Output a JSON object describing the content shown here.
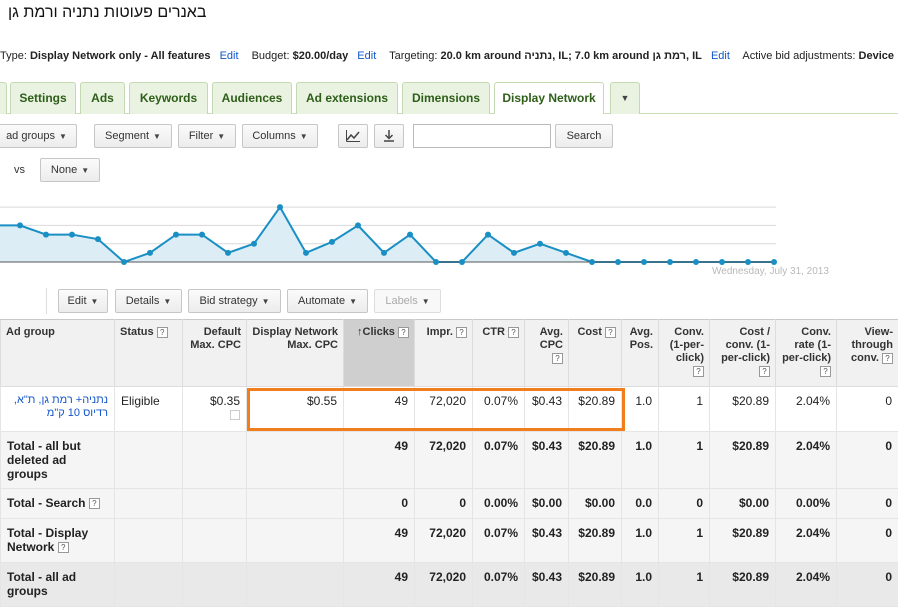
{
  "page": {
    "title": "באנרים פעוטות נתניה ורמת גן"
  },
  "infobar": {
    "type_label": "Type:",
    "type_value": "Display Network only - All features",
    "budget_label": "Budget:",
    "budget_value": "$20.00/day",
    "targeting_label": "Targeting:",
    "targeting_value": "20.0 km around נתניה, IL; 7.0 km around רמת גן, IL",
    "bid_adj_label": "Active bid adjustments:",
    "bid_adj_value": "Device",
    "edit_label": "Edit"
  },
  "tabs": [
    {
      "label": "Settings"
    },
    {
      "label": "Ads"
    },
    {
      "label": "Keywords"
    },
    {
      "label": "Audiences"
    },
    {
      "label": "Ad extensions"
    },
    {
      "label": "Dimensions"
    },
    {
      "label": "Display Network"
    },
    {
      "label": "▼"
    }
  ],
  "toolbar": {
    "adgroups_label": "ad groups",
    "segment_label": "Segment",
    "filter_label": "Filter",
    "columns_label": "Columns",
    "search_placeholder": "",
    "search_label": "Search",
    "chart_icon": "line-chart-icon",
    "download_icon": "download-icon"
  },
  "compare": {
    "vs_label": "vs",
    "none_label": "None"
  },
  "chart": {
    "date_label": "Wednesday, July 31, 2013",
    "line_color": "#1a8fc4"
  },
  "chart_data": {
    "type": "area",
    "title": "",
    "xlabel": "",
    "ylabel": "",
    "x_end_label": "Wednesday, July 31, 2013",
    "values": [
      4,
      4,
      3,
      3,
      2.5,
      0,
      1,
      3,
      3,
      1,
      2,
      6,
      1,
      2.2,
      4,
      1,
      3,
      0,
      0,
      3,
      1,
      2,
      1,
      0,
      0,
      0,
      0,
      0,
      0,
      0,
      0
    ],
    "ylim": [
      0,
      7
    ],
    "grid": true
  },
  "actions": {
    "edit_label": "Edit",
    "details_label": "Details",
    "bid_strategy_label": "Bid strategy",
    "automate_label": "Automate",
    "labels_label": "Labels"
  },
  "table": {
    "headers": {
      "adgroup": "Ad group",
      "status": "Status",
      "default_cpc": "Default Max. CPC",
      "display_cpc": "Display Network Max. CPC",
      "clicks": "Clicks",
      "impr": "Impr.",
      "ctr": "CTR",
      "avg_cpc": "Avg. CPC",
      "cost": "Cost",
      "avg_pos": "Avg. Pos.",
      "conv": "Conv. (1-per-click)",
      "cost_conv": "Cost / conv. (1-per-click)",
      "conv_rate": "Conv. rate (1-per-click)",
      "view_through": "View-through conv."
    },
    "help_glyph": "?",
    "sort_glyph": "↑",
    "row": {
      "adgroup": "נתניה+ רמת גן, ת\"א, רדיוס 10 ק\"מ",
      "status": "Eligible",
      "default_cpc": "$0.35",
      "display_cpc": "$0.55",
      "clicks": "49",
      "impr": "72,020",
      "ctr": "0.07%",
      "avg_cpc": "$0.43",
      "cost": "$20.89",
      "avg_pos": "1.0",
      "conv": "1",
      "cost_conv": "$20.89",
      "conv_rate": "2.04%",
      "view_through": "0"
    },
    "totals": [
      {
        "label": "Total - all but deleted ad groups",
        "clicks": "49",
        "impr": "72,020",
        "ctr": "0.07%",
        "avg_cpc": "$0.43",
        "cost": "$20.89",
        "avg_pos": "1.0",
        "conv": "1",
        "cost_conv": "$20.89",
        "conv_rate": "2.04%",
        "view_through": "0"
      },
      {
        "label": "Total - Search",
        "clicks": "0",
        "impr": "0",
        "ctr": "0.00%",
        "avg_cpc": "$0.00",
        "cost": "$0.00",
        "avg_pos": "0.0",
        "conv": "0",
        "cost_conv": "$0.00",
        "conv_rate": "0.00%",
        "view_through": "0"
      },
      {
        "label": "Total - Display Network",
        "clicks": "49",
        "impr": "72,020",
        "ctr": "0.07%",
        "avg_cpc": "$0.43",
        "cost": "$20.89",
        "avg_pos": "1.0",
        "conv": "1",
        "cost_conv": "$20.89",
        "conv_rate": "2.04%",
        "view_through": "0"
      },
      {
        "label": "Total - all ad groups",
        "clicks": "49",
        "impr": "72,020",
        "ctr": "0.07%",
        "avg_cpc": "$0.43",
        "cost": "$20.89",
        "avg_pos": "1.0",
        "conv": "1",
        "cost_conv": "$20.89",
        "conv_rate": "2.04%",
        "view_through": "0"
      }
    ]
  },
  "colors": {
    "tab_bg": "#eaf3e2",
    "link": "#1155cc",
    "highlight_border": "#f07e1c"
  }
}
